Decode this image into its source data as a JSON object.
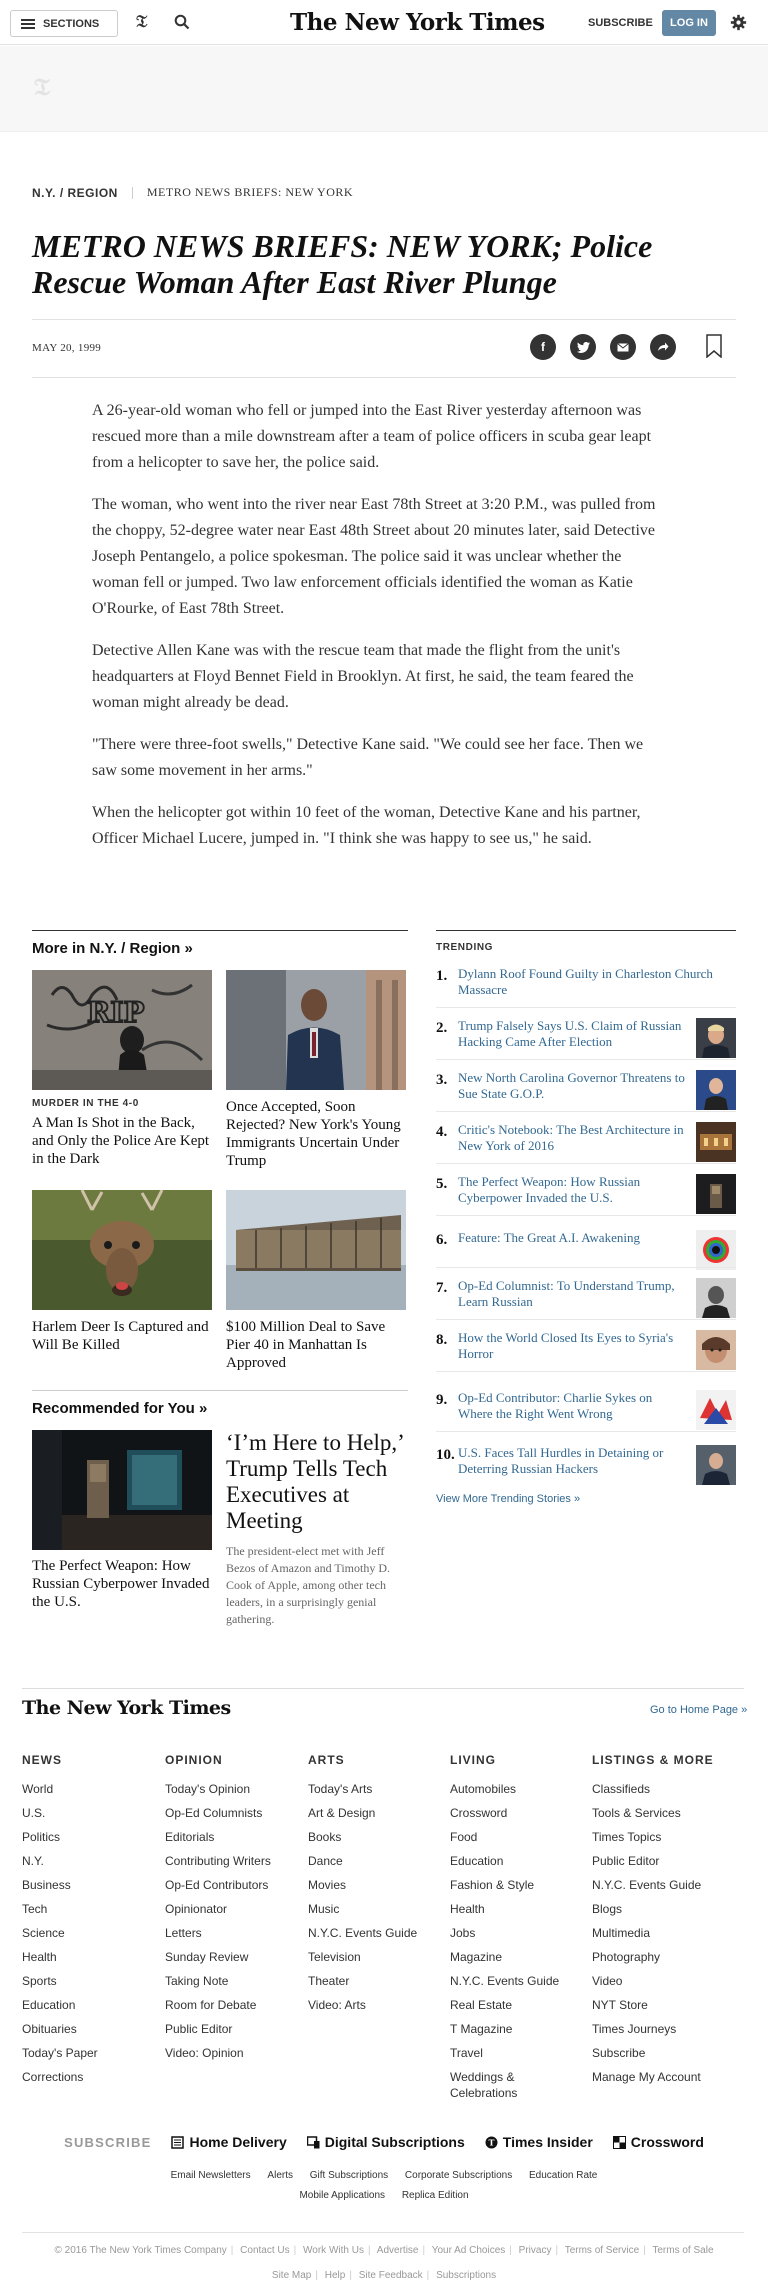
{
  "masthead": {
    "sections_label": "SECTIONS",
    "logo": "The New York Times",
    "subscribe_label": "SUBSCRIBE",
    "login_label": "LOG IN"
  },
  "article": {
    "kicker_section": "N.Y. / REGION",
    "kicker_title": "METRO NEWS BRIEFS: NEW YORK",
    "headline": "METRO NEWS BRIEFS: NEW YORK; Police Rescue Woman After East River Plunge",
    "date": "MAY 20, 1999",
    "paragraphs": [
      "A 26-year-old woman who fell or jumped into the East River yesterday afternoon was rescued more than a mile downstream after a team of police officers in scuba gear leapt from a helicopter to save her, the police said.",
      "The woman, who went into the river near East 78th Street at 3:20 P.M., was pulled from the choppy, 52-degree water near East 48th Street about 20 minutes later, said Detective Joseph Pentangelo, a police spokesman. The police said it was unclear whether the woman fell or jumped. Two law enforcement officials identified the woman as Katie O'Rourke, of East 78th Street.",
      "Detective Allen Kane was with the rescue team that made the flight from the unit's headquarters at Floyd Bennet Field in Brooklyn. At first, he said, the team feared the woman might already be dead.",
      "\"There were three-foot swells,\" Detective Kane said. \"We could see her face. Then we saw some movement in her arms.\"",
      "When the helicopter got within 10 feet of the woman, Detective Kane and his partner, Officer Michael Lucere, jumped in. \"I think she was happy to see us,\" he said."
    ]
  },
  "more_in": {
    "heading": "More in N.Y. / Region »",
    "stories": [
      {
        "kicker": "MURDER IN THE 4-0",
        "title": "A Man Is Shot in the Back, and Only the Police Are Kept in the Dark"
      },
      {
        "kicker": "",
        "title": "Once Accepted, Soon Rejected? New York's Young Immigrants Uncertain Under Trump"
      },
      {
        "kicker": "",
        "title": "Harlem Deer Is Captured and Will Be Killed"
      },
      {
        "kicker": "",
        "title": "$100 Million Deal to Save Pier 40 in Manhattan Is Approved"
      }
    ]
  },
  "recommended": {
    "heading": "Recommended for You »",
    "small_title": "The Perfect Weapon: How Russian Cyberpower Invaded the U.S.",
    "big_title": "‘I’m Here to Help,’ Trump Tells Tech Executives at Meeting",
    "summary": "The president-elect met with Jeff Bezos of Amazon and Timothy D. Cook of Apple, among other tech leaders, in a surprisingly genial gathering."
  },
  "trending": {
    "heading": "TRENDING",
    "items": [
      {
        "num": "1.",
        "title": "Dylann Roof Found Guilty in Charleston Church Massacre"
      },
      {
        "num": "2.",
        "title": "Trump Falsely Says U.S. Claim of Russian Hacking Came After Election"
      },
      {
        "num": "3.",
        "title": "New North Carolina Governor Threatens to Sue State G.O.P."
      },
      {
        "num": "4.",
        "title": "Critic's Notebook: The Best Architecture in New York of 2016"
      },
      {
        "num": "5.",
        "title": "The Perfect Weapon: How Russian Cyberpower Invaded the U.S."
      },
      {
        "num": "6.",
        "title": "Feature: The Great A.I. Awakening"
      },
      {
        "num": "7.",
        "title": "Op-Ed Columnist: To Understand Trump, Learn Russian"
      },
      {
        "num": "8.",
        "title": "How the World Closed Its Eyes to Syria's Horror"
      },
      {
        "num": "9.",
        "title": "Op-Ed Contributor: Charlie Sykes on Where the Right Went Wrong"
      },
      {
        "num": "10.",
        "title": "U.S. Faces Tall Hurdles in Detaining or Deterring Russian Hackers"
      }
    ],
    "more_label": "View More Trending Stories »"
  },
  "footer": {
    "logo": "The New York Times",
    "home_link": "Go to Home Page »",
    "columns": [
      {
        "heading": "NEWS",
        "links": [
          "World",
          "U.S.",
          "Politics",
          "N.Y.",
          "Business",
          "Tech",
          "Science",
          "Health",
          "Sports",
          "Education",
          "Obituaries",
          "Today's Paper",
          "Corrections"
        ]
      },
      {
        "heading": "OPINION",
        "links": [
          "Today's Opinion",
          "Op-Ed Columnists",
          "Editorials",
          "Contributing Writers",
          "Op-Ed Contributors",
          "Opinionator",
          "Letters",
          "Sunday Review",
          "Taking Note",
          "Room for Debate",
          "Public Editor",
          "Video: Opinion"
        ]
      },
      {
        "heading": "ARTS",
        "links": [
          "Today's Arts",
          "Art & Design",
          "Books",
          "Dance",
          "Movies",
          "Music",
          "N.Y.C. Events Guide",
          "Television",
          "Theater",
          "Video: Arts"
        ]
      },
      {
        "heading": "LIVING",
        "links": [
          "Automobiles",
          "Crossword",
          "Food",
          "Education",
          "Fashion & Style",
          "Health",
          "Jobs",
          "Magazine",
          "N.Y.C. Events Guide",
          "Real Estate",
          "T Magazine",
          "Travel",
          "Weddings & Celebrations"
        ]
      },
      {
        "heading": "LISTINGS & MORE",
        "links": [
          "Classifieds",
          "Tools & Services",
          "Times Topics",
          "Public Editor",
          "N.Y.C. Events Guide",
          "Blogs",
          "Multimedia",
          "Photography",
          "Video",
          "NYT Store",
          "Times Journeys",
          "Subscribe",
          "Manage My Account"
        ]
      }
    ],
    "subscribe_label": "SUBSCRIBE",
    "subscribe_items": [
      "Home Delivery",
      "Digital Subscriptions",
      "Times Insider",
      "Crossword"
    ],
    "links_row1": [
      "Email Newsletters",
      "Alerts",
      "Gift Subscriptions",
      "Corporate Subscriptions",
      "Education Rate"
    ],
    "links_row2": [
      "Mobile Applications",
      "Replica Edition"
    ],
    "legal_row1": [
      "© 2016 The New York Times Company",
      "Contact Us",
      "Work With Us",
      "Advertise",
      "Your Ad Choices",
      "Privacy",
      "Terms of Service",
      "Terms of Sale"
    ],
    "legal_row2": [
      "Site Map",
      "Help",
      "Site Feedback",
      "Subscriptions"
    ]
  }
}
